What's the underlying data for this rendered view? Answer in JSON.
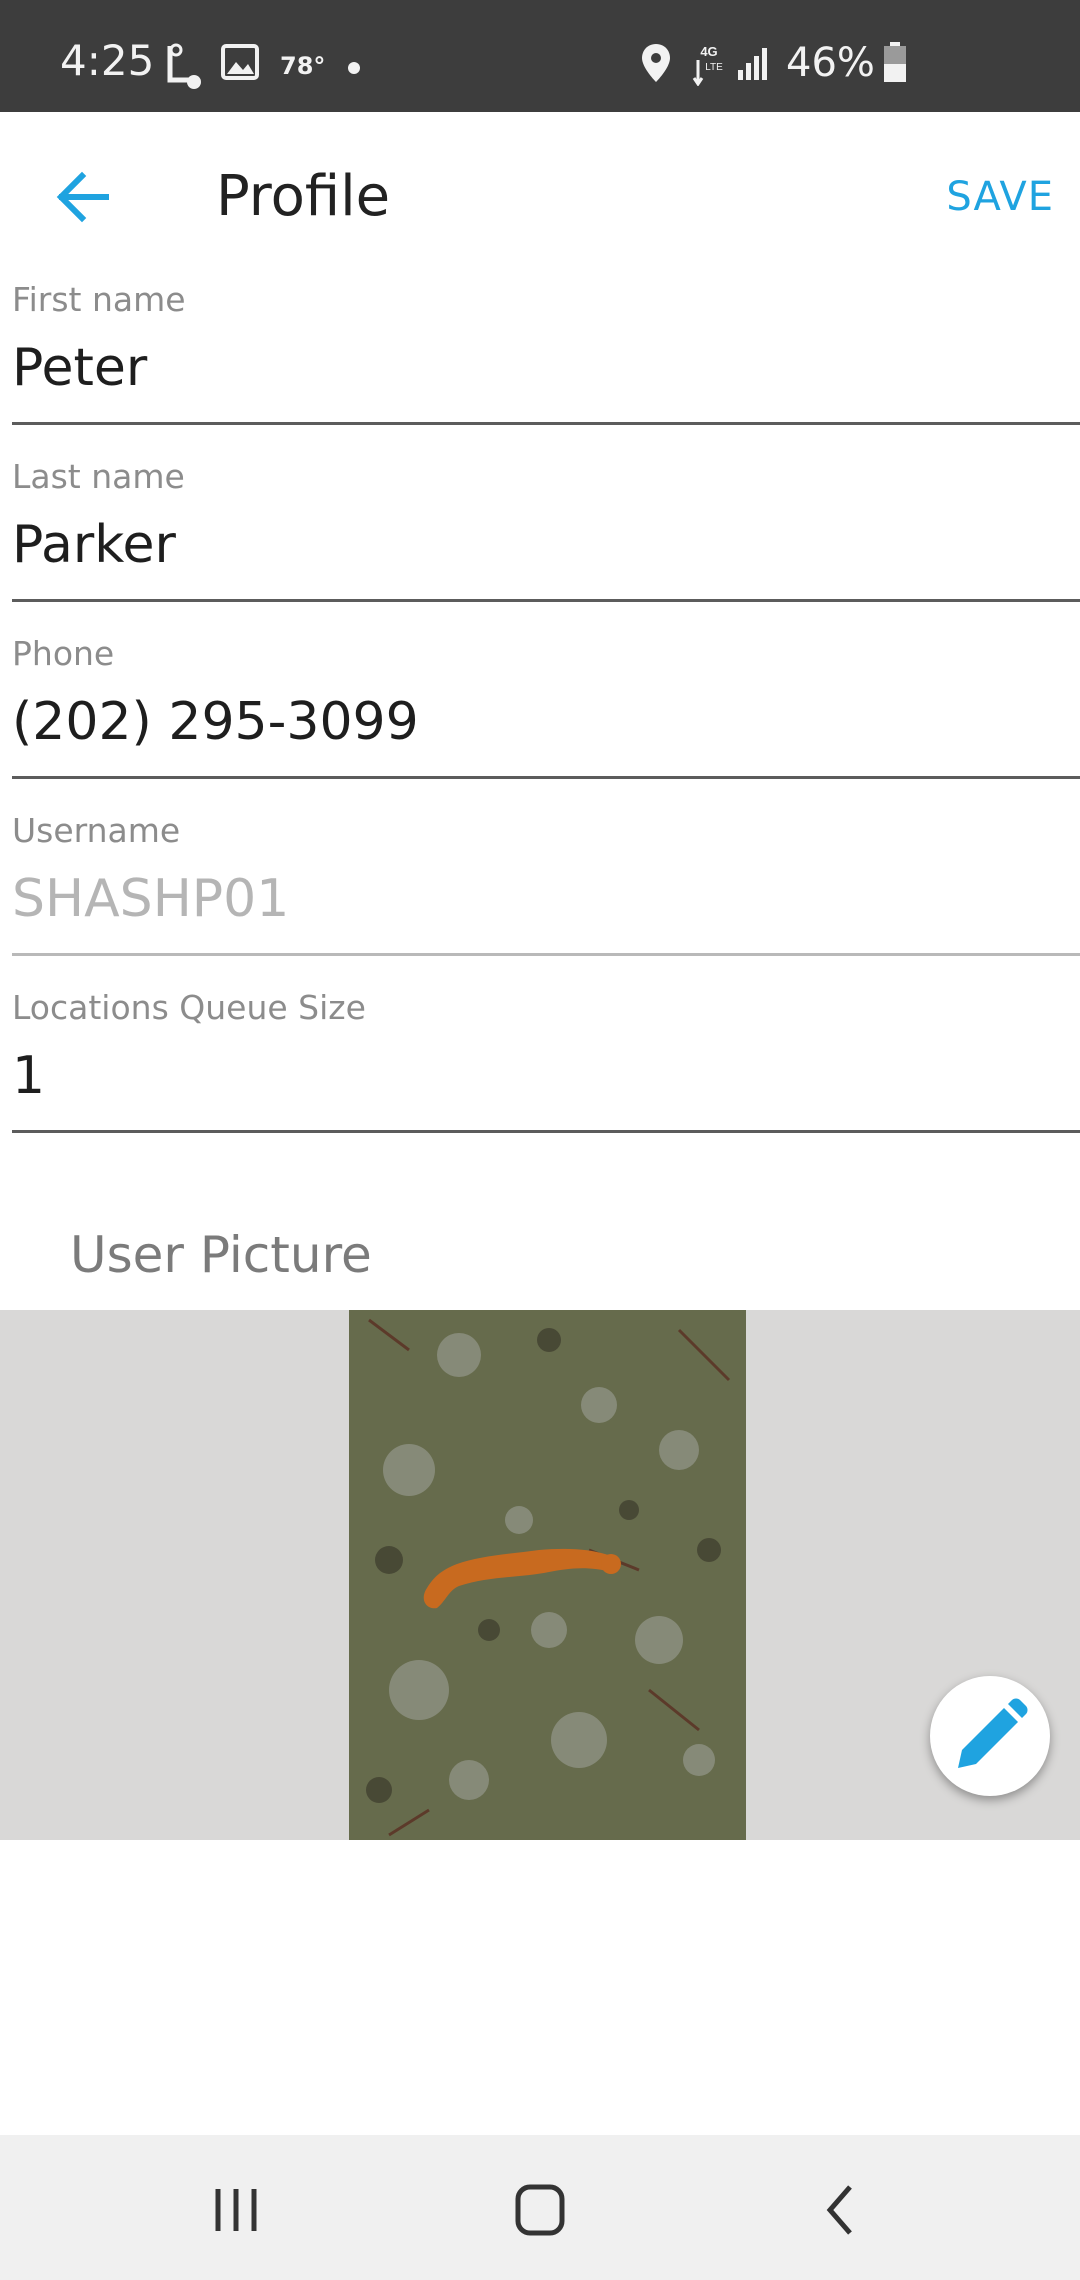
{
  "status_bar": {
    "time": "4:25",
    "temperature": "78°",
    "battery": "46%",
    "icons": [
      "navigation-b-icon",
      "gallery-icon",
      "location-icon",
      "4g-lte-icon",
      "signal-icon",
      "battery-icon"
    ]
  },
  "app_bar": {
    "title": "Profile",
    "save_label": "SAVE",
    "accent_color": "#1fa3e0"
  },
  "fields": [
    {
      "label": "First name",
      "value": "Peter",
      "editable": true
    },
    {
      "label": "Last name",
      "value": "Parker",
      "editable": true
    },
    {
      "label": "Phone",
      "value": "(202) 295-3099",
      "editable": true
    },
    {
      "label": "Username",
      "value": "SHASHP01",
      "editable": false
    },
    {
      "label": "Locations Queue Size",
      "value": "1",
      "editable": true
    }
  ],
  "picture_section": {
    "title": "User Picture",
    "edit_icon": "pencil-icon"
  },
  "nav_bar": {
    "icons": [
      "recents-icon",
      "home-icon",
      "back-icon"
    ]
  }
}
